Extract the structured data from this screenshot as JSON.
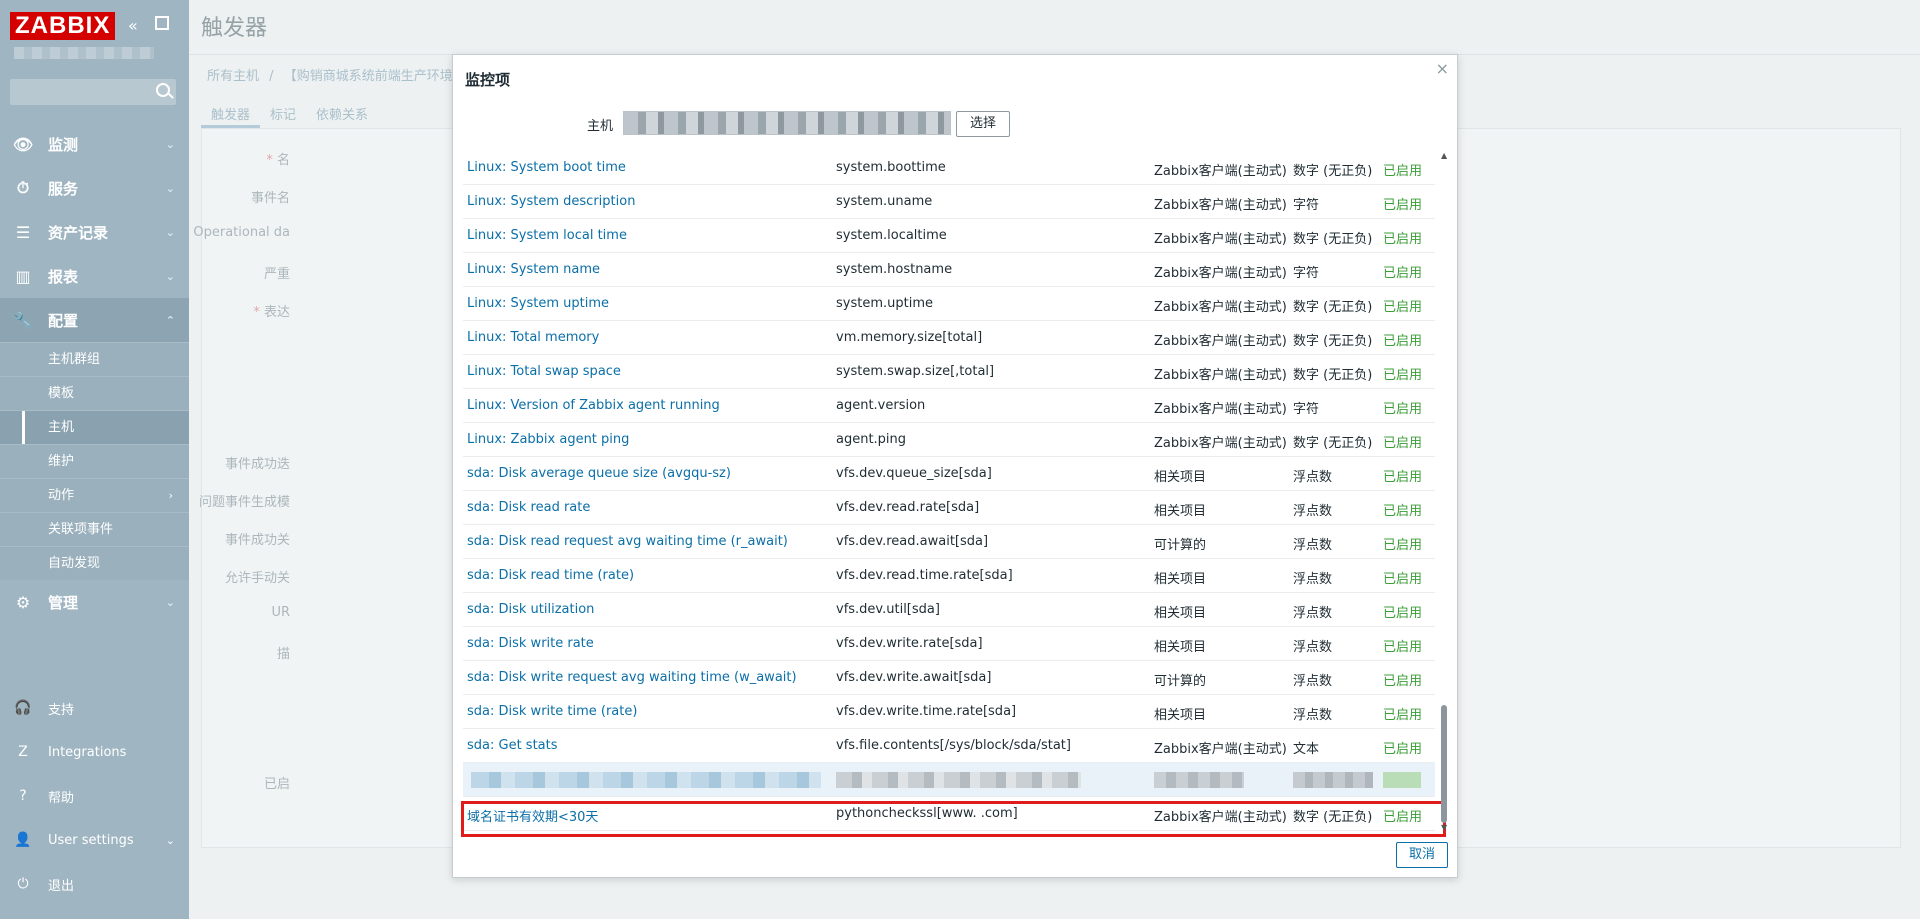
{
  "sidebar": {
    "logo": "ZABBIX",
    "menu": [
      {
        "label": "监测",
        "icon": "eye-icon"
      },
      {
        "label": "服务",
        "icon": "clock-icon"
      },
      {
        "label": "资产记录",
        "icon": "list-icon"
      },
      {
        "label": "报表",
        "icon": "chart-icon"
      },
      {
        "label": "配置",
        "icon": "wrench-icon"
      }
    ],
    "submenu": [
      "主机群组",
      "模板",
      "主机",
      "维护",
      "动作",
      "关联项事件",
      "自动发现"
    ],
    "admin": "管理",
    "bottom": [
      {
        "label": "支持",
        "icon": "headset-icon"
      },
      {
        "label": "Integrations",
        "icon": "zabbix-z-icon"
      },
      {
        "label": "帮助",
        "icon": "help-icon"
      },
      {
        "label": "User settings",
        "icon": "user-icon"
      },
      {
        "label": "退出",
        "icon": "power-icon"
      }
    ]
  },
  "page": {
    "title": "触发器",
    "breadcrumb": [
      "所有主机",
      "/",
      "【购销商城系统前端生产环境"
    ],
    "tabs": [
      "触发器",
      "标记",
      "依赖关系"
    ],
    "form_labels": [
      "名",
      "事件名",
      "Operational da",
      "严重",
      "表达",
      "事件成功迭",
      "问题事件生成模",
      "事件成功关",
      "允许手动关",
      "UR",
      "描",
      "已启"
    ]
  },
  "modal": {
    "title": "监控项",
    "host_label": "主机",
    "select_button": "选择",
    "cancel_button": "取消",
    "rows": [
      {
        "name": "Linux: System boot time",
        "key": "system.boottime",
        "type": "Zabbix客户端(主动式)",
        "value_type": "数字 (无正负)",
        "status": "已启用"
      },
      {
        "name": "Linux: System description",
        "key": "system.uname",
        "type": "Zabbix客户端(主动式)",
        "value_type": "字符",
        "status": "已启用"
      },
      {
        "name": "Linux: System local time",
        "key": "system.localtime",
        "type": "Zabbix客户端(主动式)",
        "value_type": "数字 (无正负)",
        "status": "已启用"
      },
      {
        "name": "Linux: System name",
        "key": "system.hostname",
        "type": "Zabbix客户端(主动式)",
        "value_type": "字符",
        "status": "已启用"
      },
      {
        "name": "Linux: System uptime",
        "key": "system.uptime",
        "type": "Zabbix客户端(主动式)",
        "value_type": "数字 (无正负)",
        "status": "已启用"
      },
      {
        "name": "Linux: Total memory",
        "key": "vm.memory.size[total]",
        "type": "Zabbix客户端(主动式)",
        "value_type": "数字 (无正负)",
        "status": "已启用"
      },
      {
        "name": "Linux: Total swap space",
        "key": "system.swap.size[,total]",
        "type": "Zabbix客户端(主动式)",
        "value_type": "数字 (无正负)",
        "status": "已启用"
      },
      {
        "name": "Linux: Version of Zabbix agent running",
        "key": "agent.version",
        "type": "Zabbix客户端(主动式)",
        "value_type": "字符",
        "status": "已启用"
      },
      {
        "name": "Linux: Zabbix agent ping",
        "key": "agent.ping",
        "type": "Zabbix客户端(主动式)",
        "value_type": "数字 (无正负)",
        "status": "已启用"
      },
      {
        "name": "sda: Disk average queue size (avgqu-sz)",
        "key": "vfs.dev.queue_size[sda]",
        "type": "相关项目",
        "value_type": "浮点数",
        "status": "已启用"
      },
      {
        "name": "sda: Disk read rate",
        "key": "vfs.dev.read.rate[sda]",
        "type": "相关项目",
        "value_type": "浮点数",
        "status": "已启用"
      },
      {
        "name": "sda: Disk read request avg waiting time (r_await)",
        "key": "vfs.dev.read.await[sda]",
        "type": "可计算的",
        "value_type": "浮点数",
        "status": "已启用"
      },
      {
        "name": "sda: Disk read time (rate)",
        "key": "vfs.dev.read.time.rate[sda]",
        "type": "相关项目",
        "value_type": "浮点数",
        "status": "已启用"
      },
      {
        "name": "sda: Disk utilization",
        "key": "vfs.dev.util[sda]",
        "type": "相关项目",
        "value_type": "浮点数",
        "status": "已启用"
      },
      {
        "name": "sda: Disk write rate",
        "key": "vfs.dev.write.rate[sda]",
        "type": "相关项目",
        "value_type": "浮点数",
        "status": "已启用"
      },
      {
        "name": "sda: Disk write request avg waiting time (w_await)",
        "key": "vfs.dev.write.await[sda]",
        "type": "可计算的",
        "value_type": "浮点数",
        "status": "已启用"
      },
      {
        "name": "sda: Disk write time (rate)",
        "key": "vfs.dev.write.time.rate[sda]",
        "type": "相关项目",
        "value_type": "浮点数",
        "status": "已启用"
      },
      {
        "name": "sda: Get stats",
        "key": "vfs.file.contents[/sys/block/sda/stat]",
        "type": "Zabbix客户端(主动式)",
        "value_type": "文本",
        "status": "已启用"
      }
    ],
    "last_row": {
      "name": "域名证书有效期<30天",
      "key": "pythoncheckssl[www.        .com]",
      "type": "Zabbix客户端(主动式)",
      "value_type": "数字 (无正负)",
      "status": "已启用"
    }
  }
}
